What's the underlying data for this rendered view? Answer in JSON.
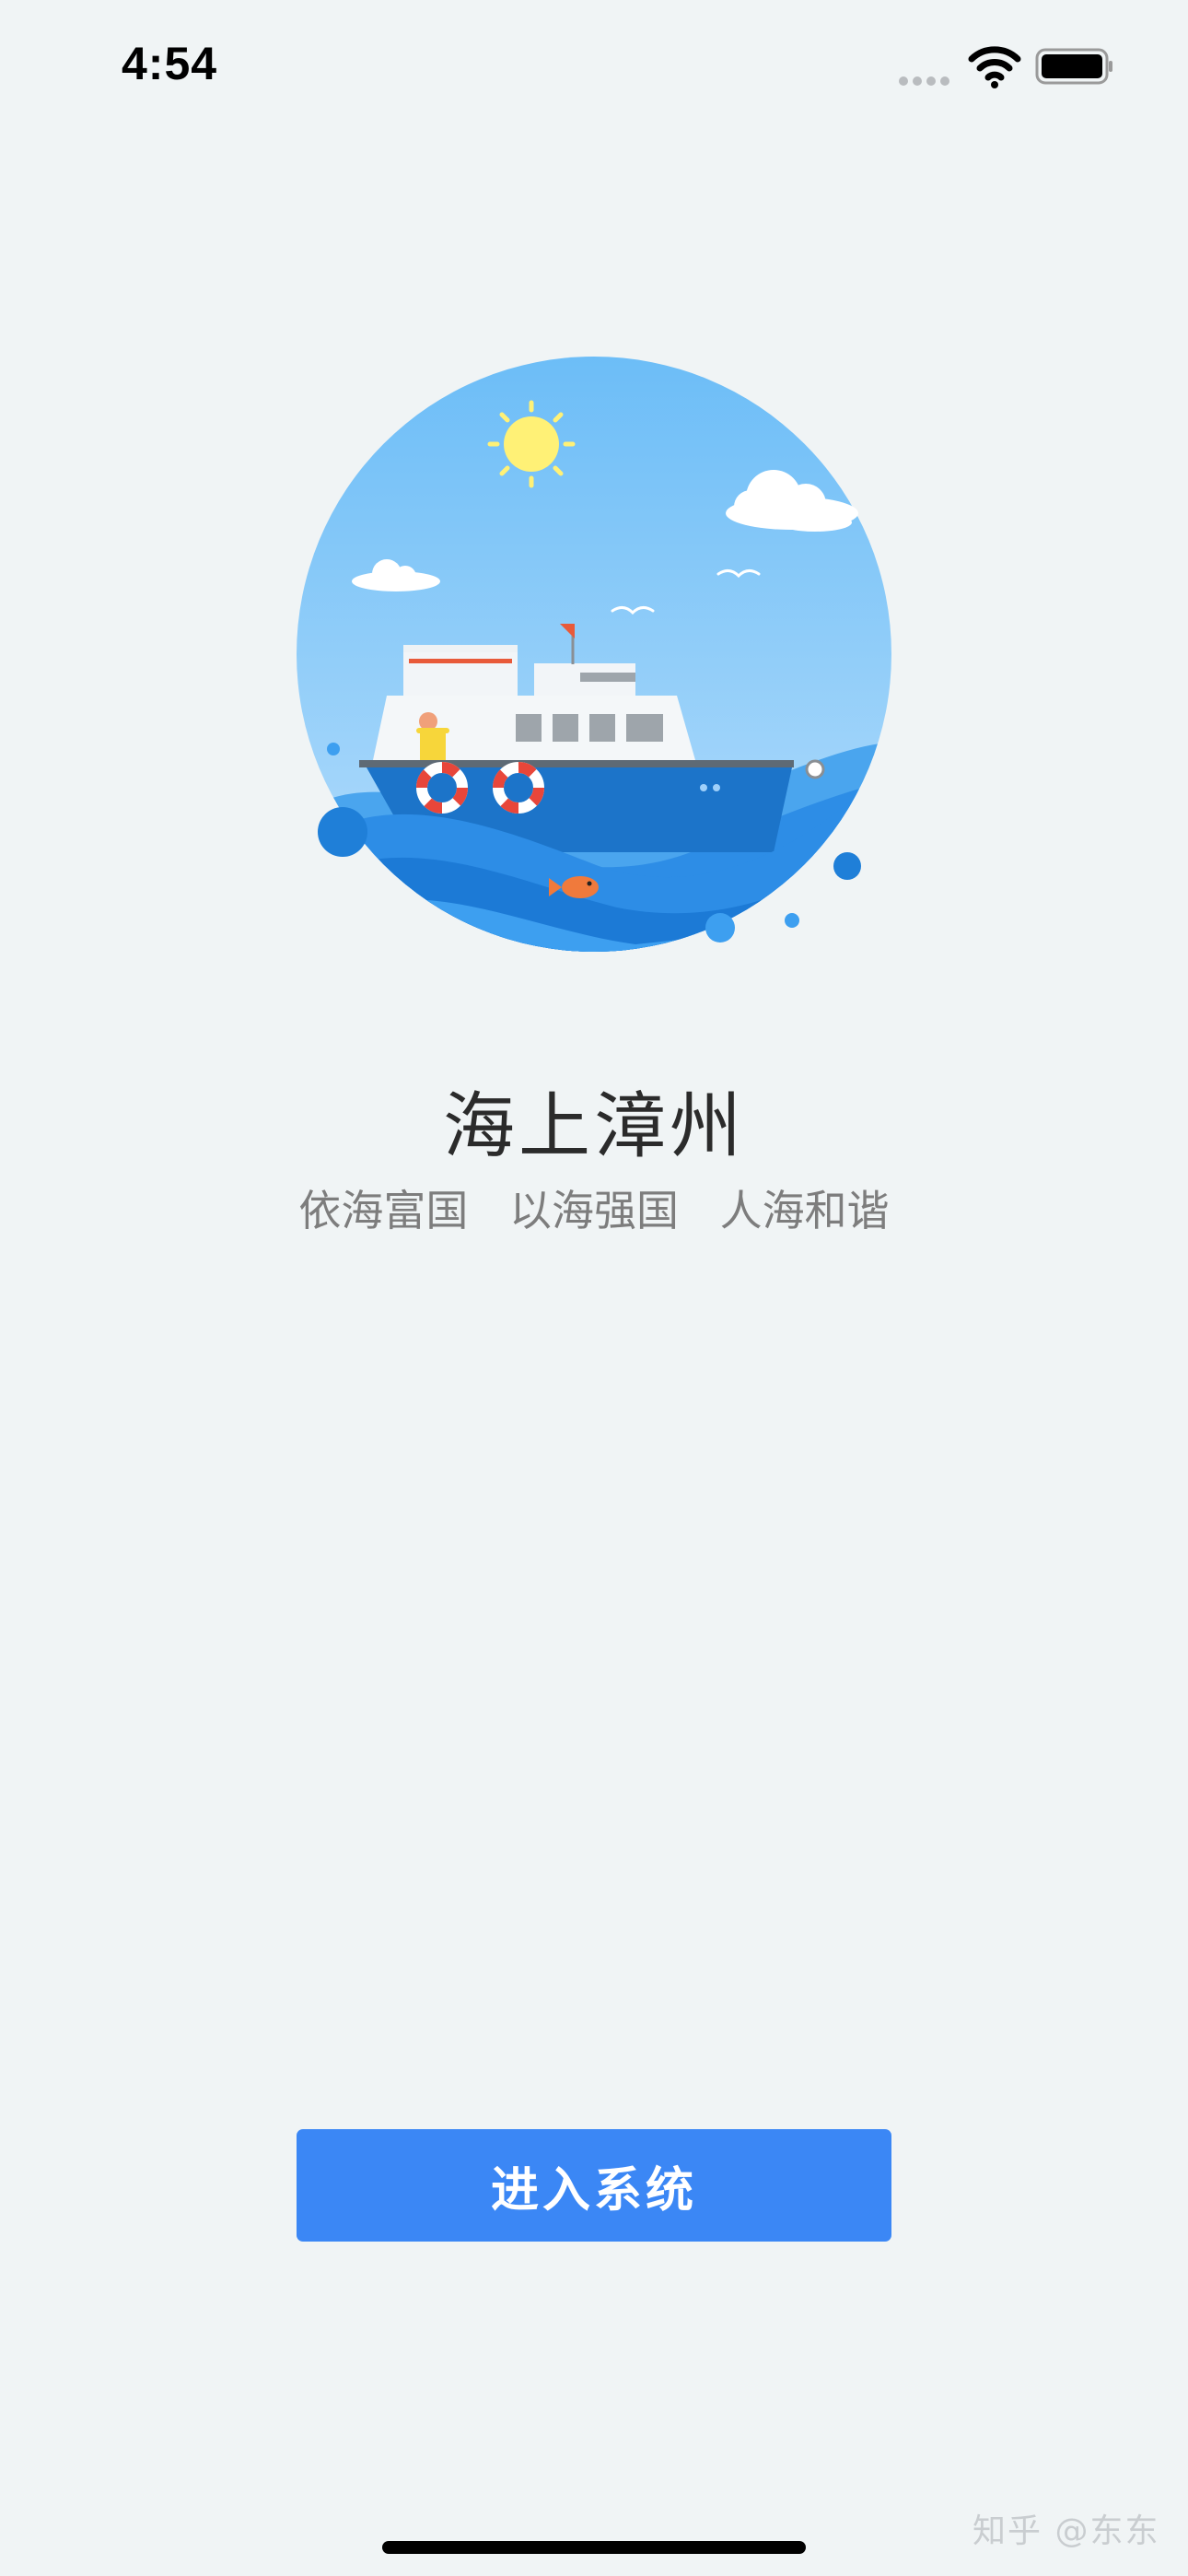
{
  "status_bar": {
    "time": "4:54",
    "signal_icon": "cellular-signal-icon",
    "wifi_icon": "wifi-icon",
    "battery_icon": "battery-icon"
  },
  "illustration": {
    "icon": "ship-on-sea-illustration"
  },
  "app": {
    "title": "海上漳州",
    "slogan": "依海富国 以海强国 人海和谐"
  },
  "actions": {
    "enter_label": "进入系统"
  },
  "watermark": "知乎 @东东",
  "colors": {
    "background": "#f0f4f5",
    "button": "#3b87f5",
    "sky": "#7cc6f8",
    "sea": "#2d8de6"
  }
}
